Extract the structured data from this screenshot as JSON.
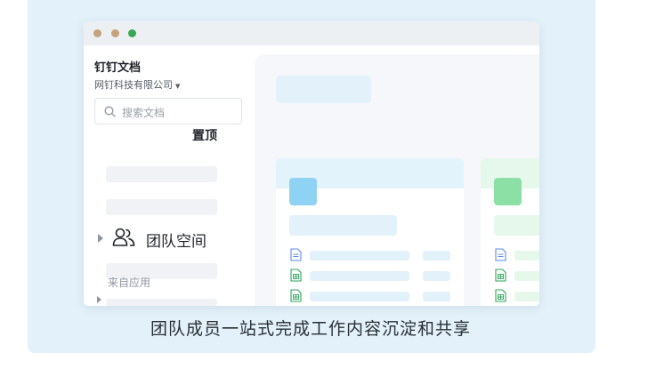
{
  "window": {
    "buttons": [
      "close",
      "minimize",
      "zoom"
    ],
    "colors": {
      "close": "#c4a27e",
      "minimize": "#c4a27e",
      "zoom": "#3aa757"
    }
  },
  "sidebar": {
    "app_title": "钉钉文档",
    "org_name": "网钉科技有限公司",
    "org_caret_icon": "caret-down-icon",
    "search": {
      "placeholder": "搜索文档",
      "icon": "search-icon"
    },
    "team_space": {
      "label": "团队空间",
      "icon": "team-icon",
      "expand_icon": "triangle-right-icon"
    },
    "from_apps": {
      "label": "来自应用",
      "expand_icon": "triangle-right-icon"
    }
  },
  "main": {
    "section_title": "置顶",
    "cards": [
      {
        "accent": "#8fd3f4",
        "header_bg": "#e3f3fb",
        "file_icons": [
          "doc-icon",
          "sheet-icon",
          "sheet-icon"
        ]
      },
      {
        "accent": "#8ce0a6",
        "header_bg": "#e6f7ec",
        "file_icons": [
          "doc-icon",
          "sheet-icon",
          "sheet-icon"
        ]
      }
    ]
  },
  "caption": "团队成员一站式完成工作内容沉淀和共享",
  "colors": {
    "stage_bg": "#e3f1fa",
    "placeholder": "#f1f2f5",
    "doc_blue": "#5b8def",
    "sheet_green": "#2fa45a"
  }
}
